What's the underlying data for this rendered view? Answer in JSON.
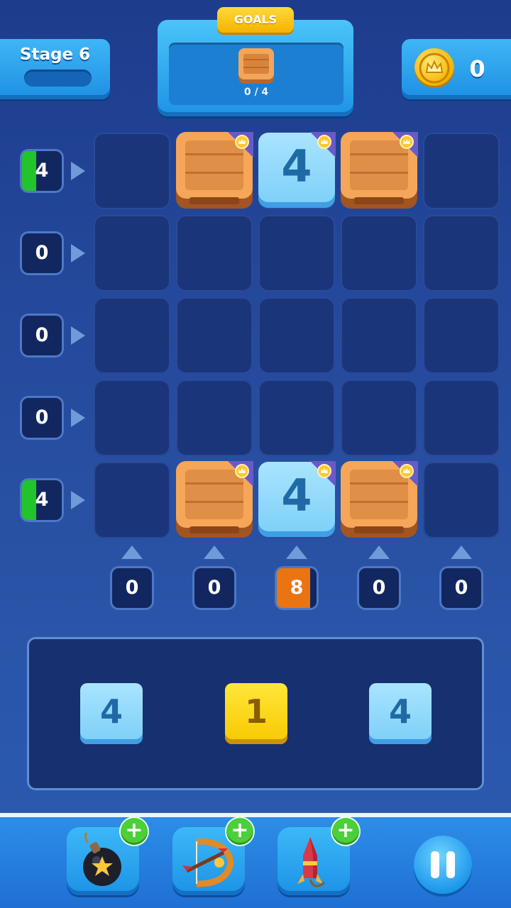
{
  "header": {
    "stage_label": "Stage 6",
    "goals_label": "GOALS",
    "goal_item_icon": "wooden-crate-icon",
    "goal_progress": "0 / 4",
    "coins": "0",
    "coin_icon": "crown-coin-icon"
  },
  "board": {
    "rows": [
      [
        "",
        "crate",
        "4",
        "crate",
        ""
      ],
      [
        "",
        "",
        "",
        "",
        ""
      ],
      [
        "",
        "",
        "",
        "",
        ""
      ],
      [
        "",
        "",
        "",
        "",
        ""
      ],
      [
        "",
        "crate",
        "4",
        "crate",
        ""
      ]
    ],
    "row_indicators": [
      {
        "value": "4",
        "fill_fraction": 0.35
      },
      {
        "value": "0",
        "fill_fraction": 0
      },
      {
        "value": "0",
        "fill_fraction": 0
      },
      {
        "value": "0",
        "fill_fraction": 0
      },
      {
        "value": "4",
        "fill_fraction": 0.35
      }
    ],
    "col_indicators": [
      {
        "value": "0",
        "fill_fraction": 0
      },
      {
        "value": "0",
        "fill_fraction": 0
      },
      {
        "value": "8",
        "fill_fraction": 1
      },
      {
        "value": "0",
        "fill_fraction": 0
      },
      {
        "value": "0",
        "fill_fraction": 0
      }
    ]
  },
  "tray": {
    "pieces": [
      {
        "value": "4",
        "color": "blue"
      },
      {
        "value": "1",
        "color": "yellow"
      },
      {
        "value": "4",
        "color": "blue"
      }
    ]
  },
  "toolbar": {
    "tools": [
      {
        "icon": "bomb-icon"
      },
      {
        "icon": "crossbow-icon"
      },
      {
        "icon": "firework-rocket-icon"
      }
    ],
    "plus_label": "+",
    "pause_icon": "pause-icon"
  },
  "colors": {
    "row_fill": "#22c42b",
    "col_fill": "#ea7411",
    "tile_blue": "#8fd8fb",
    "tile_yellow": "#f7c800"
  }
}
